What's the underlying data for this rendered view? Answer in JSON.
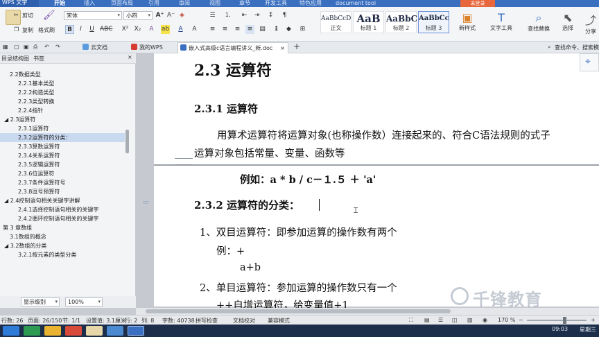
{
  "menubar": {
    "app": "WPS 文字",
    "items": [
      "开始",
      "插入",
      "页面布局",
      "引用",
      "审阅",
      "视图",
      "章节",
      "开发工具",
      "特色应用",
      "document tool"
    ],
    "login": "未登录"
  },
  "ribbon": {
    "cut": "剪切",
    "copy": "复制",
    "paste_format": "格式刷",
    "font_name": "宋体",
    "font_size": "小四",
    "styles": [
      {
        "sample": "AaBbCcD",
        "label": "正文"
      },
      {
        "sample": "AaB",
        "label": "标题 1"
      },
      {
        "sample": "AaBbC",
        "label": "标题 2"
      },
      {
        "sample": "AaBbCc",
        "label": "标题 3"
      }
    ],
    "new_style": "新样式",
    "text_tool": "文字工具",
    "find_replace": "查找替换",
    "select": "选择",
    "share": "分享"
  },
  "tabs": [
    {
      "label": "云文档"
    },
    {
      "label": "我的WPS"
    },
    {
      "label": "嵌入式高级c语言编程讲义_新.doc"
    }
  ],
  "search_hint": "查找命令、搜索模",
  "nav": {
    "tab_outline": "目录结构图",
    "tab_bookmark": "书签",
    "items": [
      {
        "label": "2.2数据类型",
        "indent": 1
      },
      {
        "label": "2.2.1基本类型",
        "indent": 2
      },
      {
        "label": "2.2.2构造类型",
        "indent": 2
      },
      {
        "label": "2.2.3类型转换",
        "indent": 2
      },
      {
        "label": "2.2.4指针",
        "indent": 2
      },
      {
        "label": "◢ 2.3运算符",
        "indent": 1
      },
      {
        "label": "2.3.1运算符",
        "indent": 2
      },
      {
        "label": "2.3.2运算符的分类：",
        "indent": 2
      },
      {
        "label": "2.3.3算数运算符",
        "indent": 2
      },
      {
        "label": "2.3.4关系运算符",
        "indent": 2
      },
      {
        "label": "2.3.5逻辑运算符",
        "indent": 2
      },
      {
        "label": "2.3.6位运算符",
        "indent": 2
      },
      {
        "label": "2.3.7条件运算符号",
        "indent": 2
      },
      {
        "label": "2.3.8逗号预算符",
        "indent": 2
      },
      {
        "label": "◢ 2.4控制语句相关关键字讲解",
        "indent": 1
      },
      {
        "label": "2.4.1选择控制语句相关的关键字",
        "indent": 2
      },
      {
        "label": "2.4.2循环控制语句相关的关键字",
        "indent": 2
      },
      {
        "label": "第 3 章数组",
        "indent": 0
      },
      {
        "label": "3.1数组的概念",
        "indent": 1
      },
      {
        "label": "◢ 3.2数组的分类",
        "indent": 1
      },
      {
        "label": "3.2.1按元素的类型分类",
        "indent": 2
      }
    ],
    "level": "显示级别",
    "zoom": "100%"
  },
  "document": {
    "h2": "2.3  运算符",
    "h3a": "2.3.1  运算符",
    "para1": "用算术运算符将运算对象(也称操作数）连接起来的、符合C语法规则的式子",
    "para2": "运算对象包括常量、变量、函数等",
    "example": "例如：a * b / c－１.５ ＋ 'a'",
    "h3b": "2.3.2  运算符的分类：",
    "item1": "1、双目运算符：即参加运算的操作数有两个",
    "item1b": "例：+",
    "item1c": "a+b",
    "item2": "2、单目运算符：参加运算的操作数只有一个",
    "item2b": "++自增运算符，给变量值+1"
  },
  "status": {
    "words": "行数: 26",
    "page": "页面: 26/150",
    "section": "节: 1/1",
    "setting": "设置值: 3.1厘米",
    "row": "行: 2",
    "col": "列: 8",
    "chars": "字数: 40738",
    "spell": "拼写检查",
    "proof": "文档校对",
    "compat": "兼容模式",
    "zoom": "170 %"
  },
  "taskbar": {
    "time": "09:03",
    "day": "星期三"
  },
  "watermark": "千锋教育"
}
